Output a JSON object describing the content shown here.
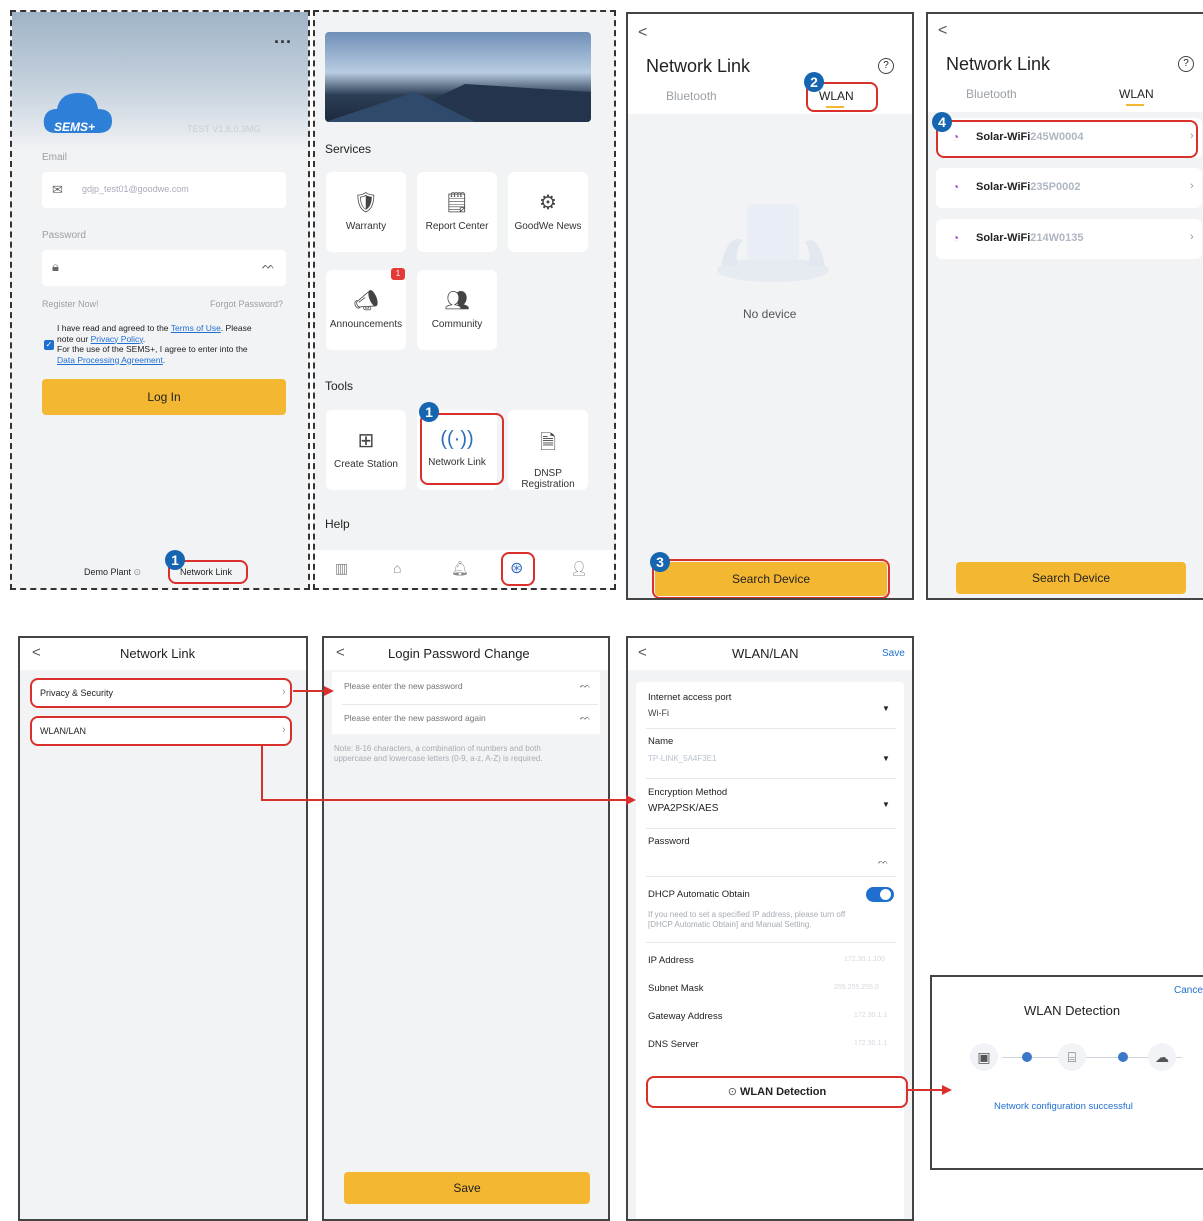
{
  "s1": {
    "more_icon": "ellipsis-icon",
    "logo_text": "SEMS+",
    "watermark": "TEST V1.8.0.3MG",
    "email_label": "Email",
    "email_value": "gdjp_test01@goodwe.com",
    "password_label": "Password",
    "register": "Register Now!",
    "forgot": "Forgot Password?",
    "agree_line1_a": "I have read and agreed to the ",
    "terms": "Terms of Use",
    "agree_line1_b": ". Please",
    "agree_line2_a": "note our ",
    "privacy": "Privacy Policy",
    "agree_line2_b": ".",
    "agree_line3": "For the use of the SEMS+, I agree to enter into the",
    "dpa": "Data Processing Agreement",
    "agree_line4_b": ".",
    "login": "Log In",
    "demo": "Demo Plant",
    "network_link": "Network Link",
    "step": "1"
  },
  "s2": {
    "services": "Services",
    "warranty": "Warranty",
    "report_center": "Report Center",
    "goodwe_news": "GoodWe News",
    "announcements": "Announcements",
    "announce_badge": "1",
    "community": "Community",
    "tools": "Tools",
    "create_station": "Create Station",
    "network_link": "Network Link",
    "dnsp_1": "DNSP",
    "dnsp_2": "Registration",
    "help": "Help",
    "step": "1"
  },
  "s3": {
    "back": "<",
    "title": "Network Link",
    "help": "?",
    "tab_bluetooth": "Bluetooth",
    "tab_wlan": "WLAN",
    "empty": "No device",
    "search": "Search Device",
    "step_tab": "2",
    "step_search": "3"
  },
  "s4": {
    "back": "<",
    "title": "Network Link",
    "help": "?",
    "tab_bluetooth": "Bluetooth",
    "tab_wlan": "WLAN",
    "devices": [
      {
        "prefix": "Solar-WiFi",
        "suffix": "245W0004"
      },
      {
        "prefix": "Solar-WiFi",
        "suffix": "235P0002"
      },
      {
        "prefix": "Solar-WiFi",
        "suffix": "214W0135"
      }
    ],
    "search": "Search Device",
    "step": "4"
  },
  "s5": {
    "back": "<",
    "title": "Network Link",
    "item1": "Privacy & Security",
    "item2": "WLAN/LAN"
  },
  "s6": {
    "back": "<",
    "title": "Login Password Change",
    "ph1": "Please enter the new password",
    "ph2": "Please enter the new password again",
    "note1": "Note: 8-16 characters, a combination of numbers and both",
    "note2": "uppercase and lowercase letters (0-9, a-z, A-Z) is required.",
    "save": "Save"
  },
  "s7": {
    "back": "<",
    "title": "WLAN/LAN",
    "save": "Save",
    "port_label": "Internet access port",
    "port_value": "Wi-Fi",
    "name_label": "Name",
    "name_value": "TP-LINK_5A4F3E1",
    "enc_label": "Encryption Method",
    "enc_value": "WPA2PSK/AES",
    "pw_label": "Password",
    "dhcp_label": "DHCP Automatic Obtain",
    "dhcp_note1": "If you need to set a specified IP address, please turn off",
    "dhcp_note2": "[DHCP Automatic Obtain] and Manual Setting.",
    "ip_label": "IP Address",
    "ip_value": "172.30.1.100",
    "mask_label": "Subnet Mask",
    "mask_value": "255.255.255.0",
    "gw_label": "Gateway Address",
    "gw_value": "172.30.1.1",
    "dns_label": "DNS Server",
    "dns_value": "172.30.1.1",
    "detect": "WLAN Detection",
    "dhcp_on": true
  },
  "s8": {
    "cancel": "Cance",
    "title": "WLAN Detection",
    "success": "Network configuration successful"
  },
  "colors": {
    "accent_yellow": "#f4b731",
    "link_blue": "#1f6fd1",
    "highlight_red": "#d9302b",
    "step_blue": "#1565b0",
    "wifi_purple": "#a24bc9"
  }
}
